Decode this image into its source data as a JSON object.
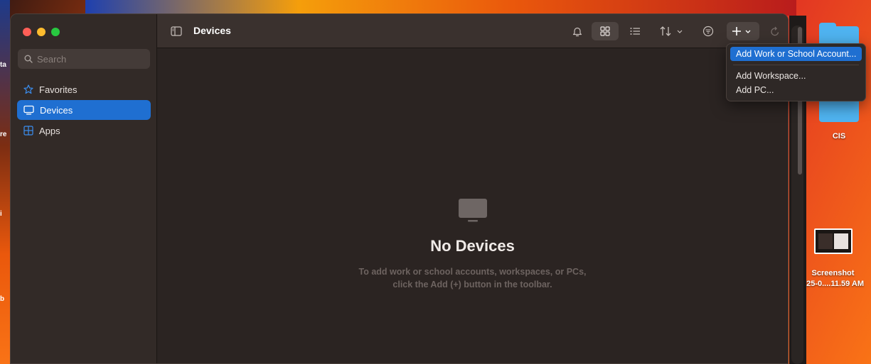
{
  "app": {
    "title": "Devices"
  },
  "sidebar": {
    "search_placeholder": "Search",
    "items": [
      {
        "label": "Favorites",
        "icon": "star-icon",
        "active": false
      },
      {
        "label": "Devices",
        "icon": "display-icon",
        "active": true
      },
      {
        "label": "Apps",
        "icon": "apps-grid-icon",
        "active": false
      }
    ]
  },
  "toolbar": {
    "icons": [
      "sidebar-toggle-icon",
      "bell-icon",
      "grid-view-icon",
      "list-view-icon",
      "sort-icon",
      "filter-icon",
      "add-icon",
      "refresh-icon"
    ]
  },
  "empty_state": {
    "title": "No Devices",
    "line1": "To add work or school accounts, workspaces, or PCs,",
    "line2": "click the Add (+) button in the toolbar."
  },
  "add_menu": {
    "items": [
      {
        "label": "Add Work or School Account...",
        "highlighted": true
      },
      {
        "label": "Add Workspace...",
        "highlighted": false
      },
      {
        "label": "Add PC...",
        "highlighted": false
      }
    ]
  },
  "desktop": {
    "items": [
      {
        "label": "CIS",
        "icon": "folder-icon"
      },
      {
        "label_line1": "Screenshot",
        "label_line2": "025-0....11.59 AM",
        "icon": "image-thumbnail-icon"
      }
    ],
    "left_edge_fragments": [
      "ta",
      "re",
      "i",
      "b"
    ]
  },
  "colors": {
    "accent": "#1f6fd1",
    "window_bg": "#2b2422",
    "sidebar_bg": "#322a27"
  }
}
